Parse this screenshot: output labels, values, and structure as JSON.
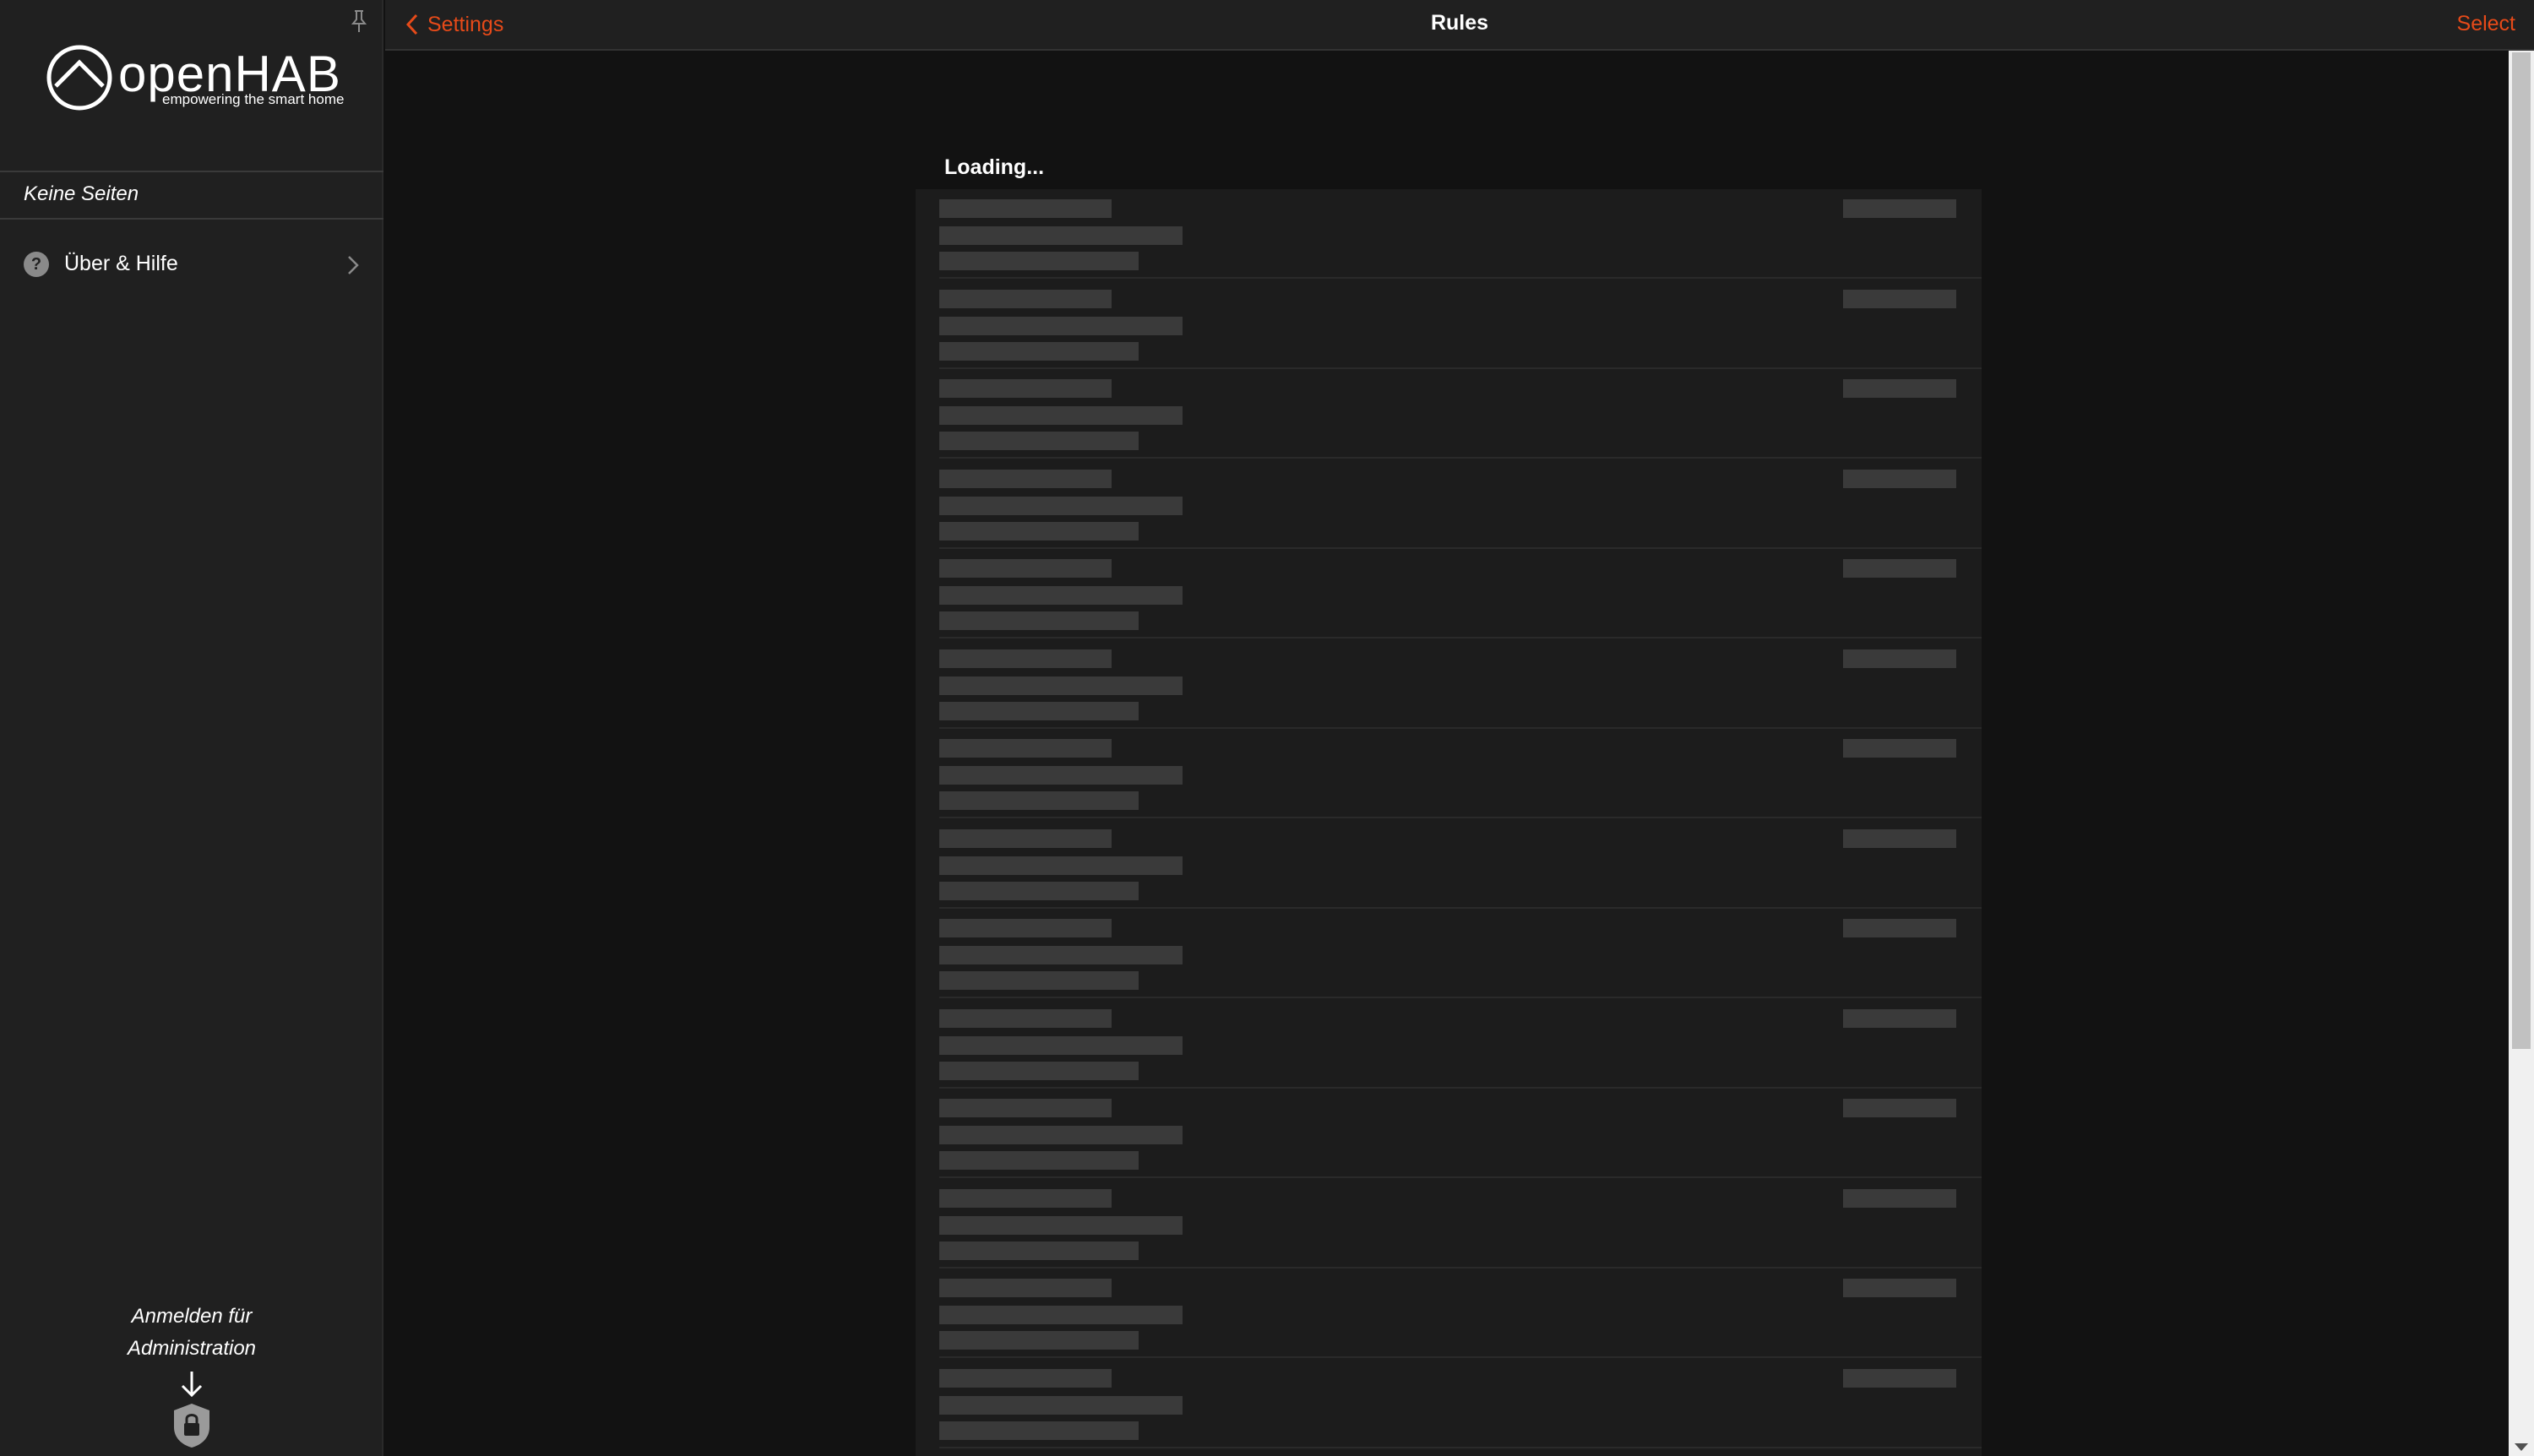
{
  "sidebar": {
    "logo_text": "openHAB",
    "logo_tagline": "empowering the smart home",
    "section_title": "Keine Seiten",
    "items": [
      {
        "label": "Über & Hilfe",
        "icon": "help-icon"
      }
    ],
    "login_hint_line1": "Anmelden für",
    "login_hint_line2": "Administration"
  },
  "navbar": {
    "back_label": "Settings",
    "title": "Rules",
    "right_label": "Select"
  },
  "main": {
    "block_title": "Loading...",
    "skeleton_rows": 14
  },
  "colors": {
    "accent": "#e64a19",
    "sidebar_bg": "#202020",
    "page_bg": "#121212",
    "list_bg": "#1c1c1c",
    "skeleton": "#3a3a3a"
  }
}
